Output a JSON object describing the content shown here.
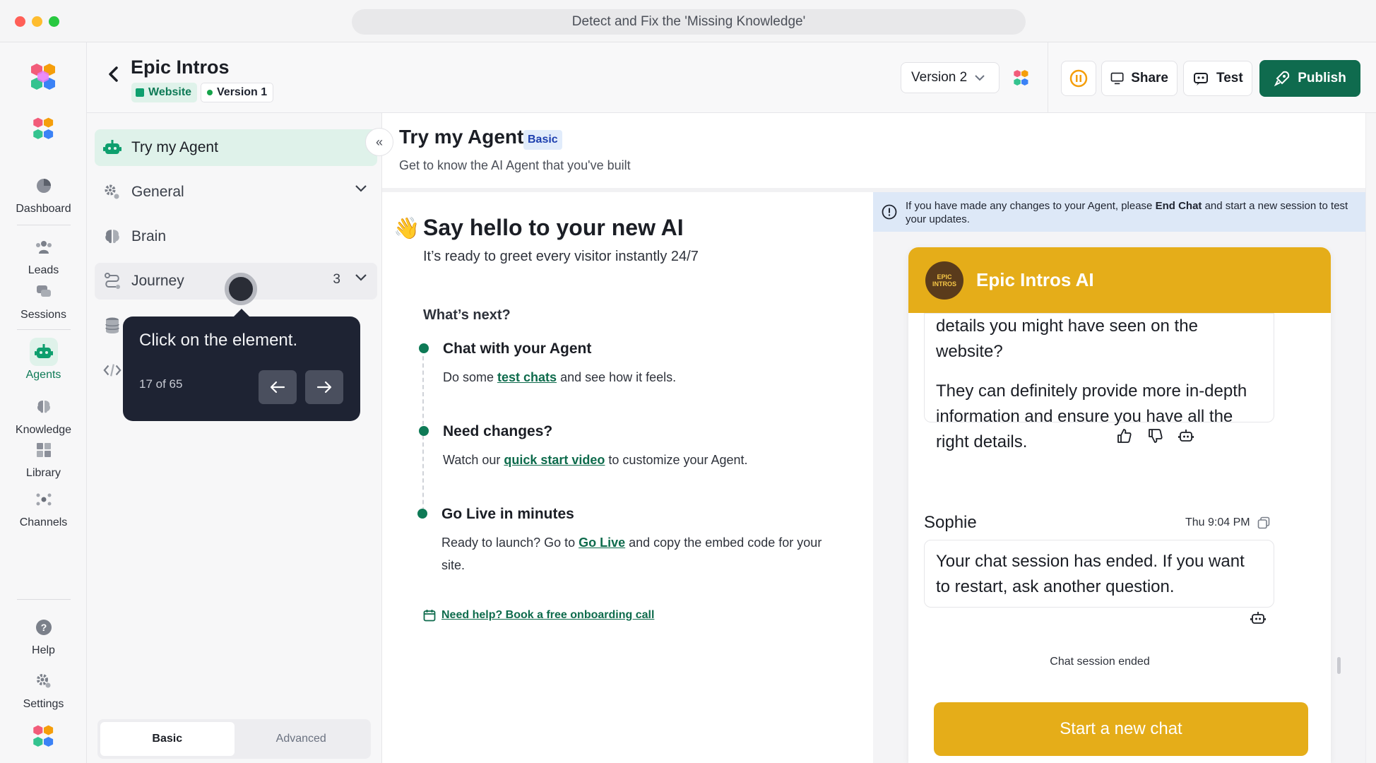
{
  "window": {
    "url_title": "Detect and Fix the 'Missing Knowledge'"
  },
  "rail": {
    "items": [
      {
        "label": "Dashboard"
      },
      {
        "label": "Leads"
      },
      {
        "label": "Sessions"
      },
      {
        "label": "Agents"
      },
      {
        "label": "Knowledge"
      },
      {
        "label": "Library"
      },
      {
        "label": "Channels"
      },
      {
        "label": "Help"
      },
      {
        "label": "Settings"
      }
    ],
    "active": "Agents"
  },
  "header": {
    "agent_name": "Epic Intros",
    "channel_tag": "Website",
    "version_tag": "Version 1",
    "version_select": "Version 2",
    "share_label": "Share",
    "test_label": "Test",
    "publish_label": "Publish"
  },
  "sidenav": {
    "items": [
      {
        "label": "Try my Agent"
      },
      {
        "label": "General"
      },
      {
        "label": "Brain"
      },
      {
        "label": "Journey",
        "count": "3"
      }
    ],
    "mode_basic": "Basic",
    "mode_advanced": "Advanced"
  },
  "tour": {
    "message": "Click on the element.",
    "step": "17 of 65"
  },
  "page": {
    "title": "Try my Agent",
    "badge": "Basic",
    "subtitle": "Get to know the AI Agent that you've built"
  },
  "welcome": {
    "emoji": "👋",
    "title": "Say hello to your new AI",
    "subtitle": "It’s ready to greet every visitor instantly 24/7",
    "next_title": "What’s next?",
    "steps": [
      {
        "title": "Chat with your Agent",
        "pre": "Do some ",
        "link": "test chats",
        "post": " and see how it feels."
      },
      {
        "title": "Need changes?",
        "pre": "Watch our ",
        "link": "quick start video",
        "post": " to customize your Agent."
      },
      {
        "title": "Go Live in minutes",
        "pre": "Ready to launch? Go to ",
        "link": "Go Live",
        "post": " and copy the embed code for your site."
      }
    ],
    "help_link": "Need help? Book a free onboarding call"
  },
  "preview": {
    "notice_pre": "If you have made any changes to your Agent, please ",
    "notice_bold": "End Chat",
    "notice_post": " and start a new session to test your updates.",
    "chat_title": "Epic Intros AI",
    "avatar_text": "EPIC INTROS",
    "bot_msg_1": "details you might have seen on the website?",
    "bot_msg_2": "They can definitely provide more in-depth information and ensure you have all the right details.",
    "sender": "Sophie",
    "time": "Thu 9:04 PM",
    "bot_msg_3": "Your chat session has ended. If you want to restart, ask another question.",
    "ended": "Chat session ended",
    "start_button": "Start a new chat"
  },
  "colors": {
    "brand_green": "#0f6b4e",
    "chat_yellow": "#e5ad19",
    "active_bg": "#dff2ea",
    "tour_bg": "#1e2333"
  }
}
